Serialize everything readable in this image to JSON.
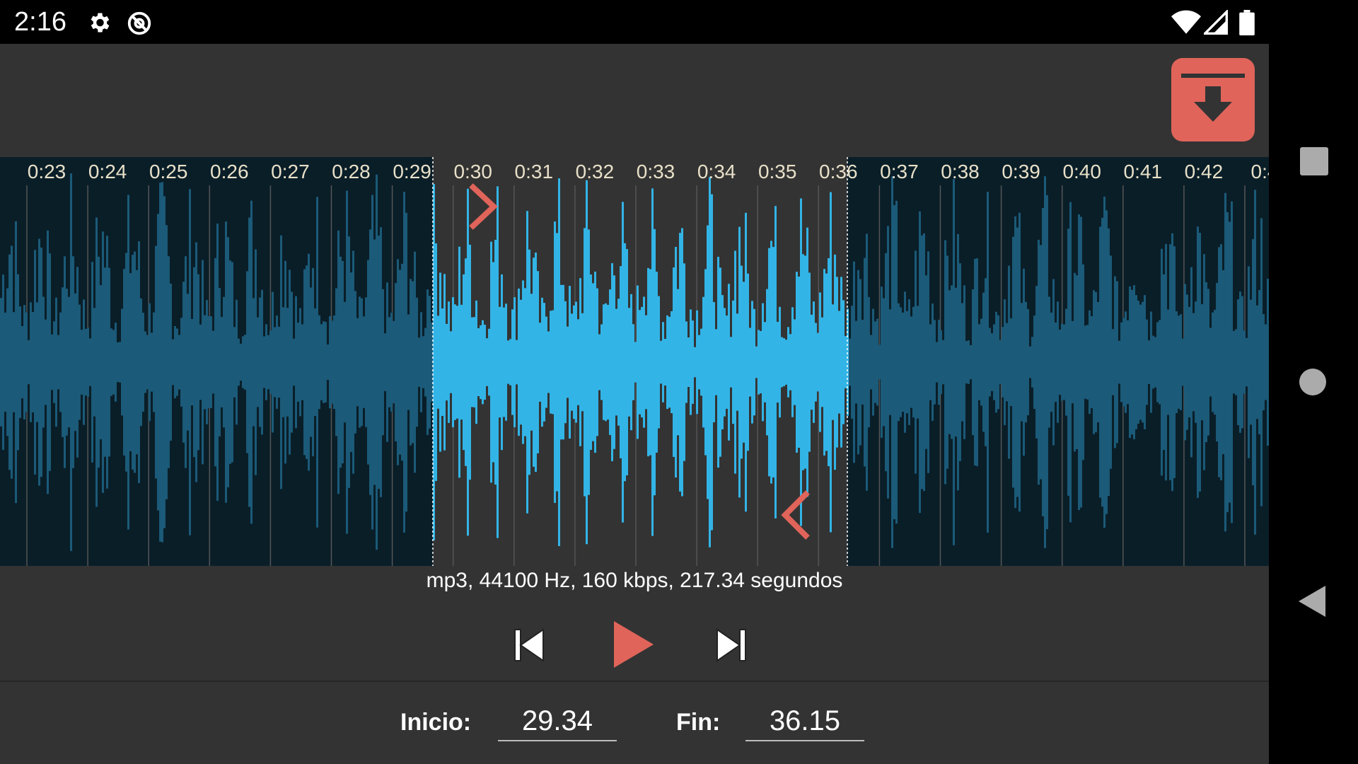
{
  "status_bar": {
    "time": "2:16",
    "icons": [
      "gear-icon",
      "at-sign-icon",
      "wifi-icon",
      "signal-icon",
      "battery-icon"
    ]
  },
  "toolbar": {
    "save_icon": "save-download-icon",
    "accent_color": "#e0645a"
  },
  "waveform": {
    "time_labels": [
      "0:23",
      "0:24",
      "0:25",
      "0:26",
      "0:27",
      "0:28",
      "0:29",
      "0:30",
      "0:31",
      "0:32",
      "0:33",
      "0:34",
      "0:35",
      "0:36",
      "0:37",
      "0:38",
      "0:39",
      "0:40",
      "0:41",
      "0:42",
      "0:4"
    ],
    "selection_start": "29.34",
    "selection_end": "36.15",
    "selected_color": "#33b4e6",
    "unselected_color": "#1b5a78",
    "background_color": "#0a1e28",
    "selection_background": "#333333",
    "start_marker_icon": "chevron-right-icon",
    "end_marker_icon": "chevron-left-icon"
  },
  "info": {
    "text": "mp3, 44100 Hz, 160 kbps, 217.34 segundos"
  },
  "controls": {
    "rewind_icon": "skip-previous-icon",
    "play_icon": "play-icon",
    "forward_icon": "skip-next-icon"
  },
  "fields": {
    "start_label": "Inicio:",
    "start_value": "29.34",
    "end_label": "Fin:",
    "end_value": "36.15"
  },
  "nav": {
    "recents_icon": "square-icon",
    "home_icon": "circle-icon",
    "back_icon": "triangle-back-icon"
  }
}
